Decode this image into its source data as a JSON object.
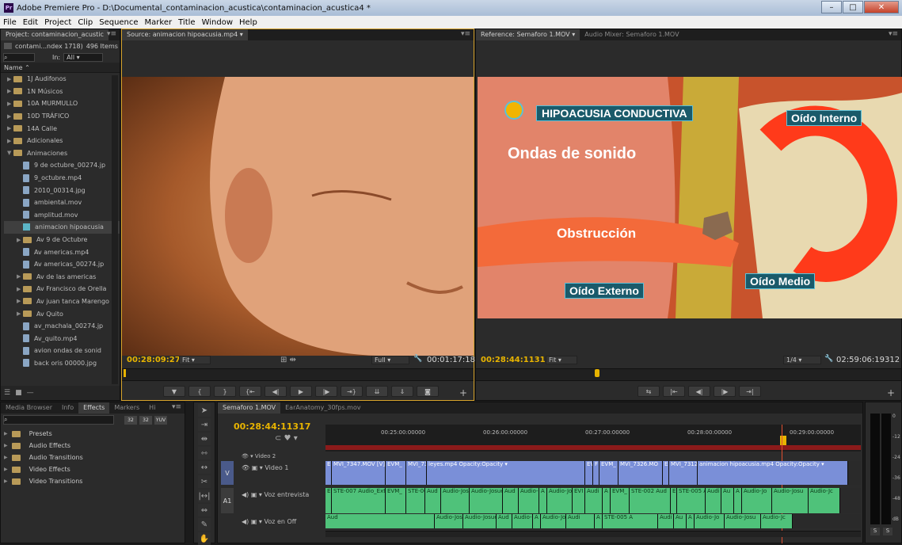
{
  "window": {
    "title": "Adobe Premiere Pro - D:\\Documental_contaminacion_acustica\\contaminacion_acustica4 *",
    "app_badge": "Pr"
  },
  "menu": [
    "File",
    "Edit",
    "Project",
    "Clip",
    "Sequence",
    "Marker",
    "Title",
    "Window",
    "Help"
  ],
  "project": {
    "tab_label": "Project: contaminacion_acustic",
    "file_label": "contami...ndex 1718)",
    "item_count": "496 Items",
    "in_label": "In:",
    "in_value": "All",
    "name_header": "Name",
    "items": [
      {
        "label": "1J Audifonos",
        "type": "folder",
        "indent": 0,
        "expanded": false
      },
      {
        "label": "1N Músicos",
        "type": "folder",
        "indent": 0,
        "expanded": false
      },
      {
        "label": "10A MURMULLO",
        "type": "folder",
        "indent": 0,
        "expanded": false
      },
      {
        "label": "10D TRÁFICO",
        "type": "folder",
        "indent": 0,
        "expanded": false
      },
      {
        "label": "14A Calle",
        "type": "folder",
        "indent": 0,
        "expanded": false
      },
      {
        "label": "Adicionales",
        "type": "folder",
        "indent": 0,
        "expanded": false
      },
      {
        "label": "Animaciones",
        "type": "folder",
        "indent": 0,
        "expanded": true
      },
      {
        "label": "9 de octubre_00274.jp",
        "type": "file",
        "indent": 1
      },
      {
        "label": "9_octubre.mp4",
        "type": "file",
        "indent": 1
      },
      {
        "label": "2010_00314.jpg",
        "type": "file",
        "indent": 1
      },
      {
        "label": "ambiental.mov",
        "type": "file",
        "indent": 1
      },
      {
        "label": "amplitud.mov",
        "type": "file",
        "indent": 1
      },
      {
        "label": "animacion hipoacusia",
        "type": "seq",
        "indent": 1,
        "selected": true
      },
      {
        "label": "Av 9 de Octubre",
        "type": "folder",
        "indent": 1,
        "expanded": false
      },
      {
        "label": "Av americas.mp4",
        "type": "file",
        "indent": 1
      },
      {
        "label": "Av americas_00274.jp",
        "type": "file",
        "indent": 1
      },
      {
        "label": "Av de las americas",
        "type": "folder",
        "indent": 1,
        "expanded": false
      },
      {
        "label": "Av Francisco de Orella",
        "type": "folder",
        "indent": 1,
        "expanded": false
      },
      {
        "label": "Av juan tanca Marengo",
        "type": "folder",
        "indent": 1,
        "expanded": false
      },
      {
        "label": "Av Quito",
        "type": "folder",
        "indent": 1,
        "expanded": false
      },
      {
        "label": "av_machala_00274.jp",
        "type": "file",
        "indent": 1
      },
      {
        "label": "Av_quito.mp4",
        "type": "file",
        "indent": 1
      },
      {
        "label": "avion ondas de sonid",
        "type": "file",
        "indent": 1
      },
      {
        "label": "back oris 00000.jpg",
        "type": "file",
        "indent": 1
      }
    ]
  },
  "source": {
    "tab_label": "Source: animacion hipoacusia.mp4",
    "timecode": "00:28:09:27",
    "fit": "Fit",
    "quality": "Full",
    "duration": "00:01:17:18"
  },
  "reference": {
    "tab_label": "Reference: Semaforo 1.MOV",
    "mixer_tab": "Audio Mixer: Semaforo 1.MOV",
    "timecode": "00:28:44:11317",
    "fit": "Fit",
    "quality": "1/4",
    "duration": "02:59:06:19312",
    "overlay": {
      "title": "HIPOACUSIA CONDUCTIVA",
      "waves": "Ondas de sonido",
      "obstruction": "Obstrucción",
      "outer": "Oído Externo",
      "middle": "Oído Medio",
      "inner": "Oído Interno"
    }
  },
  "effects": {
    "tabs": [
      "Media Browser",
      "Info",
      "Effects",
      "Markers",
      "Hi"
    ],
    "items": [
      "Presets",
      "Audio Effects",
      "Audio Transitions",
      "Video Effects",
      "Video Transitions"
    ],
    "btns": [
      "32",
      "32",
      "YUV"
    ]
  },
  "timeline": {
    "tabs": [
      "Semaforo 1.MOV",
      "EarAnatomy_30fps.mov"
    ],
    "timecode": "00:28:44:11317",
    "ruler": [
      "00:25:00:00000",
      "00:26:00:00000",
      "00:27:00:00000",
      "00:28:00:00000",
      "00:29:00:00000"
    ],
    "tracks": {
      "video2": "Video 2",
      "video1": "Video 1",
      "voz": "Voz entrevista",
      "off": "Voz en Off"
    },
    "track_tags": {
      "v": "V",
      "a1": "A1"
    },
    "video1_clips": [
      "E",
      "MVI_7347.MOV [V]",
      "EVM_",
      "MVI_73",
      "leyes.mp4  Opacity:Opacity ▾",
      "EVI",
      "F",
      "EVM_",
      "MVI_7326.MO",
      "E",
      "MVI_7312",
      "animacion hipoacusia.mp4  Opacity:Opacity ▾"
    ],
    "audio_clips": [
      "E",
      "STE-007 Audio_Extra",
      "EVM_",
      "STE-007",
      "Aud",
      "Audio-Jos",
      "Audio-Josue-",
      "Aud",
      "Audio-",
      "A",
      "Audio-Jo",
      "EVI",
      "Audi",
      "A",
      "EVM_",
      "STE-002 Aud",
      "E",
      "STE-005 A",
      "Audi",
      "Au",
      "A",
      "Audio-Jo",
      "Audio-Josu",
      "Audio-Jc"
    ],
    "off_clips": [
      "Aud",
      "Audio-Jos",
      "Audio-Josue-",
      "Aud",
      "Audio-",
      "A",
      "Audio-Jo",
      "Audi",
      "A",
      "STE-005 A",
      "Audi",
      "Au",
      "A",
      "Audio-Jo",
      "Audio-Josu",
      "Audio-Jc"
    ]
  },
  "meter_ticks": [
    "0",
    "-12",
    "-24",
    "-36",
    "-48",
    "dB"
  ],
  "meter_solo": [
    "S",
    "S"
  ]
}
